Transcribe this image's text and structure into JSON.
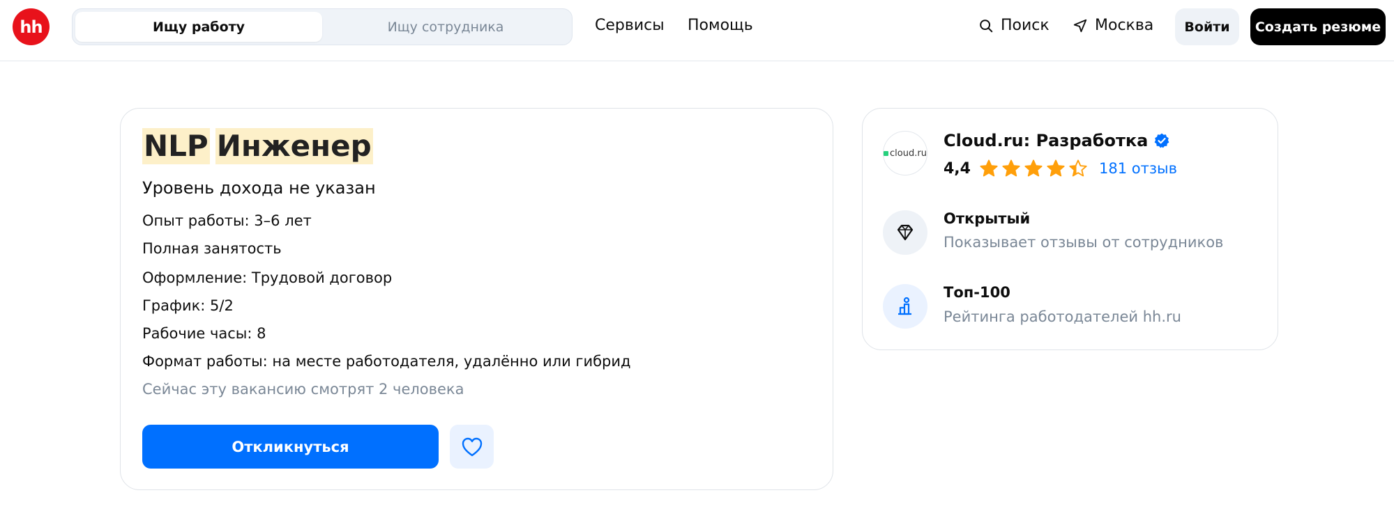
{
  "header": {
    "logo_text": "hh",
    "switch": {
      "job_seeker": "Ищу работу",
      "employer": "Ищу сотрудника"
    },
    "nav": {
      "services": "Сервисы",
      "help": "Помощь"
    },
    "search_label": "Поиск",
    "city": "Москва",
    "login": "Войти",
    "create_resume": "Создать резюме"
  },
  "vacancy": {
    "title_words": [
      "NLP",
      "Инженер"
    ],
    "salary": "Уровень дохода не указан",
    "experience": "Опыт работы: 3–6 лет",
    "employment": "Полная занятость",
    "contract": "Оформление: Трудовой договор",
    "schedule": "График: 5/2",
    "hours": "Рабочие часы: 8",
    "work_format": "Формат работы: на месте работодателя, удалённо или гибрид",
    "viewers": "Сейчас эту вакансию смотрят 2 человека",
    "apply_button": "Откликнуться"
  },
  "company": {
    "logo_text": "cloud.ru",
    "name": "Cloud.ru: Разработка",
    "rating": "4,4",
    "stars": 4.4,
    "reviews": "181 отзыв",
    "badges": [
      {
        "title": "Открытый",
        "subtitle": "Показывает отзывы от сотрудников",
        "icon": "diamond-icon"
      },
      {
        "title": "Топ-100",
        "subtitle": "Рейтинга работодателей hh.ru",
        "icon": "podium-icon"
      }
    ]
  },
  "colors": {
    "brand_red": "#e8121b",
    "primary_blue": "#0070ff",
    "star": "#ff9f0a",
    "highlight": "#fdf0c9"
  }
}
